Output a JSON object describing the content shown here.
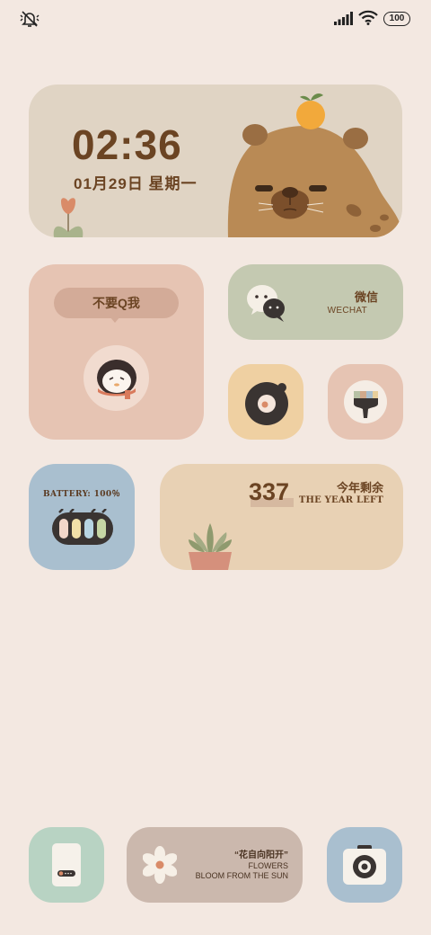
{
  "status_bar": {
    "battery_level": "100",
    "icons": [
      "mute-icon",
      "signal-icon",
      "wifi-icon",
      "battery-icon"
    ]
  },
  "clock_widget": {
    "time": "02:36",
    "date": "01月29日  星期一"
  },
  "qq_widget": {
    "bubble_text": "不要Q我"
  },
  "wechat_widget": {
    "name": "微信",
    "subtitle": "WECHAT"
  },
  "battery_widget": {
    "label": "BATTERY: 100％",
    "level_percent": 100
  },
  "year_widget": {
    "days_left": "337",
    "title": "今年剩余",
    "subtitle": "THE YEAR LEFT"
  },
  "dock": {
    "flower_quote": "“花自向阳开”",
    "flower_line1": "FLOWERS",
    "flower_line2": "BLOOM FROM THE SUN"
  },
  "colors": {
    "background": "#f3e8e1",
    "brown_text": "#6b4423",
    "clock_card": "#e0d4c4",
    "pink_card": "#e6c4b3",
    "sage_card": "#c4c9b1",
    "yellow_card": "#efd0a2",
    "blue_card": "#a9bfcf",
    "sand_card": "#e8d1b4",
    "mint_card": "#b8d3c3",
    "mauve_card": "#cbb8ad"
  }
}
